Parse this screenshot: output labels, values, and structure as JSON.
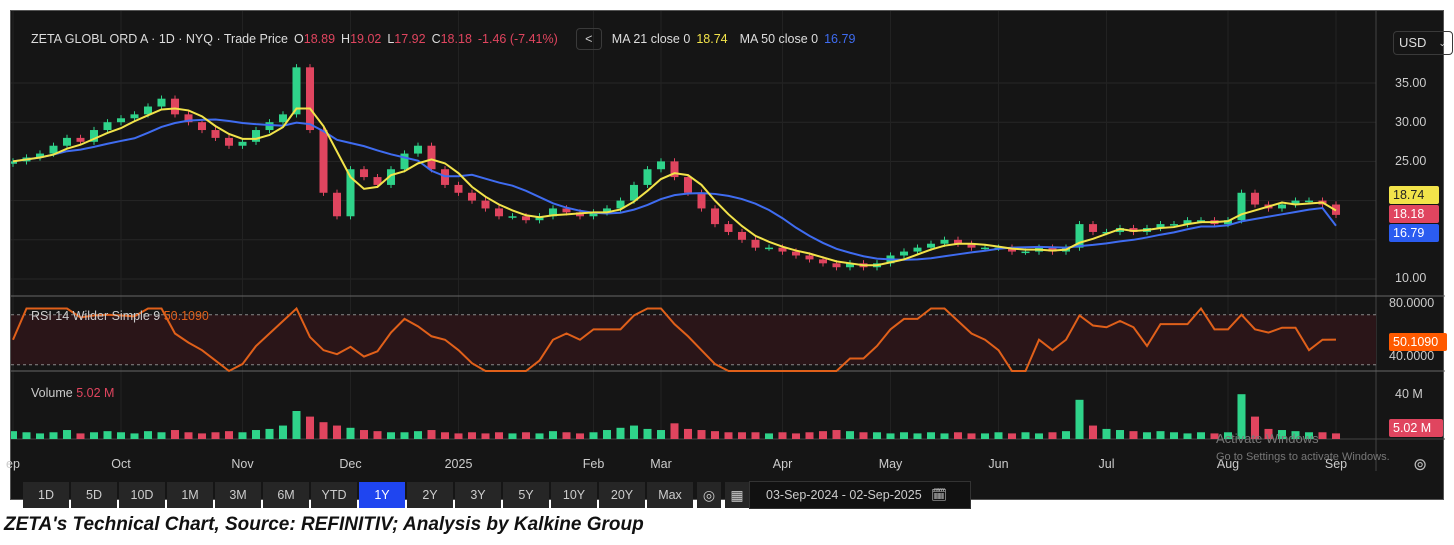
{
  "legend": {
    "symbol": "ZETA GLOBL ORD A · 1D · NYQ · Trade Price",
    "o_label": "O",
    "o": "18.89",
    "h_label": "H",
    "h": "19.02",
    "l_label": "L",
    "l": "17.92",
    "c_label": "C",
    "c": "18.18",
    "change": "-1.46 (-7.41%)",
    "nav": "<",
    "ma21_label": "MA 21 close 0",
    "ma21": "18.74",
    "ma50_label": "MA 50 close 0",
    "ma50": "16.79"
  },
  "currency": "USD",
  "price_axis": [
    "35.00",
    "30.00",
    "25.00",
    "10.00"
  ],
  "tags": {
    "ma21": "18.74",
    "close": "18.18",
    "ma50": "16.79",
    "rsi": "50.1090",
    "volume": "5.02 M"
  },
  "rsi": {
    "label": "RSI 14 Wilder Simple 9",
    "value": "50.1090",
    "axis": [
      "80.0000",
      "40.0000"
    ]
  },
  "volume": {
    "label": "Volume",
    "value": "5.02 M",
    "axis": "40 M"
  },
  "months": [
    {
      "label": "ep",
      "index": 0
    },
    {
      "label": "Oct",
      "index": 8
    },
    {
      "label": "Nov",
      "index": 17
    },
    {
      "label": "Dec",
      "index": 25
    },
    {
      "label": "2025",
      "index": 33
    },
    {
      "label": "Feb",
      "index": 43
    },
    {
      "label": "Mar",
      "index": 48
    },
    {
      "label": "Apr",
      "index": 57
    },
    {
      "label": "May",
      "index": 65
    },
    {
      "label": "Jun",
      "index": 73
    },
    {
      "label": "Jul",
      "index": 81
    },
    {
      "label": "Aug",
      "index": 90
    },
    {
      "label": "Sep",
      "index": 98
    }
  ],
  "range_buttons": [
    "1D",
    "5D",
    "10D",
    "1M",
    "3M",
    "6M",
    "YTD",
    "1Y",
    "2Y",
    "3Y",
    "5Y",
    "10Y",
    "20Y",
    "Max"
  ],
  "active_range": "1Y",
  "date_range": "03-Sep-2024  -  02-Sep-2025",
  "watermark": {
    "line1": "Activate Windows",
    "line2": "Go to Settings to activate Windows."
  },
  "caption": "ZETA's Technical Chart, Source: REFINITIV; Analysis by Kalkine Group",
  "colors": {
    "up": "#2fd38a",
    "down": "#e0455f",
    "ma21": "#f2e34a",
    "ma50": "#3f6cf0",
    "rsi": "#e0601a"
  },
  "chart_data": {
    "type": "candlestick",
    "title": "ZETA GLOBL ORD A",
    "ylim": [
      8,
      38
    ],
    "closes": [
      25,
      25.5,
      26,
      27,
      28,
      27.5,
      29,
      30,
      30.5,
      31,
      32,
      33,
      31,
      30,
      29,
      28,
      27,
      27.5,
      29,
      30,
      31,
      37,
      29,
      21,
      18,
      24,
      23,
      22,
      24,
      26,
      27,
      24,
      22,
      21,
      20,
      19,
      18,
      18,
      17.5,
      18,
      19,
      18.5,
      18,
      18.5,
      19,
      20,
      22,
      24,
      25,
      23,
      21,
      19,
      17,
      16,
      15,
      14,
      14,
      13.5,
      13,
      12.5,
      12,
      11.5,
      12,
      11.5,
      12,
      13,
      13.5,
      14,
      14.5,
      15,
      14.5,
      14,
      14,
      14,
      13.5,
      13.5,
      14,
      13.5,
      14,
      17,
      16,
      16,
      16.5,
      16,
      16.5,
      17,
      17,
      17.5,
      17.5,
      17,
      17.5,
      21,
      19.5,
      19,
      19.5,
      20,
      20,
      19.5,
      18.18
    ],
    "volume_m": [
      7,
      6,
      5,
      6,
      8,
      5,
      6,
      7,
      6,
      5,
      7,
      6,
      8,
      6,
      5,
      6,
      7,
      6,
      8,
      9,
      12,
      25,
      20,
      15,
      12,
      10,
      8,
      7,
      6,
      6,
      7,
      8,
      6,
      5,
      6,
      5,
      6,
      5,
      6,
      5,
      7,
      6,
      5,
      6,
      8,
      10,
      12,
      9,
      8,
      14,
      9,
      8,
      7,
      6,
      6,
      6,
      5,
      6,
      5,
      6,
      7,
      8,
      7,
      6,
      6,
      5,
      6,
      5,
      6,
      5,
      6,
      5,
      5,
      6,
      5,
      6,
      5,
      6,
      7,
      35,
      12,
      9,
      8,
      7,
      6,
      7,
      6,
      5,
      6,
      5,
      6,
      40,
      20,
      9,
      8,
      7,
      6,
      6,
      5.02
    ],
    "rsi_ylim": [
      25,
      85
    ]
  }
}
